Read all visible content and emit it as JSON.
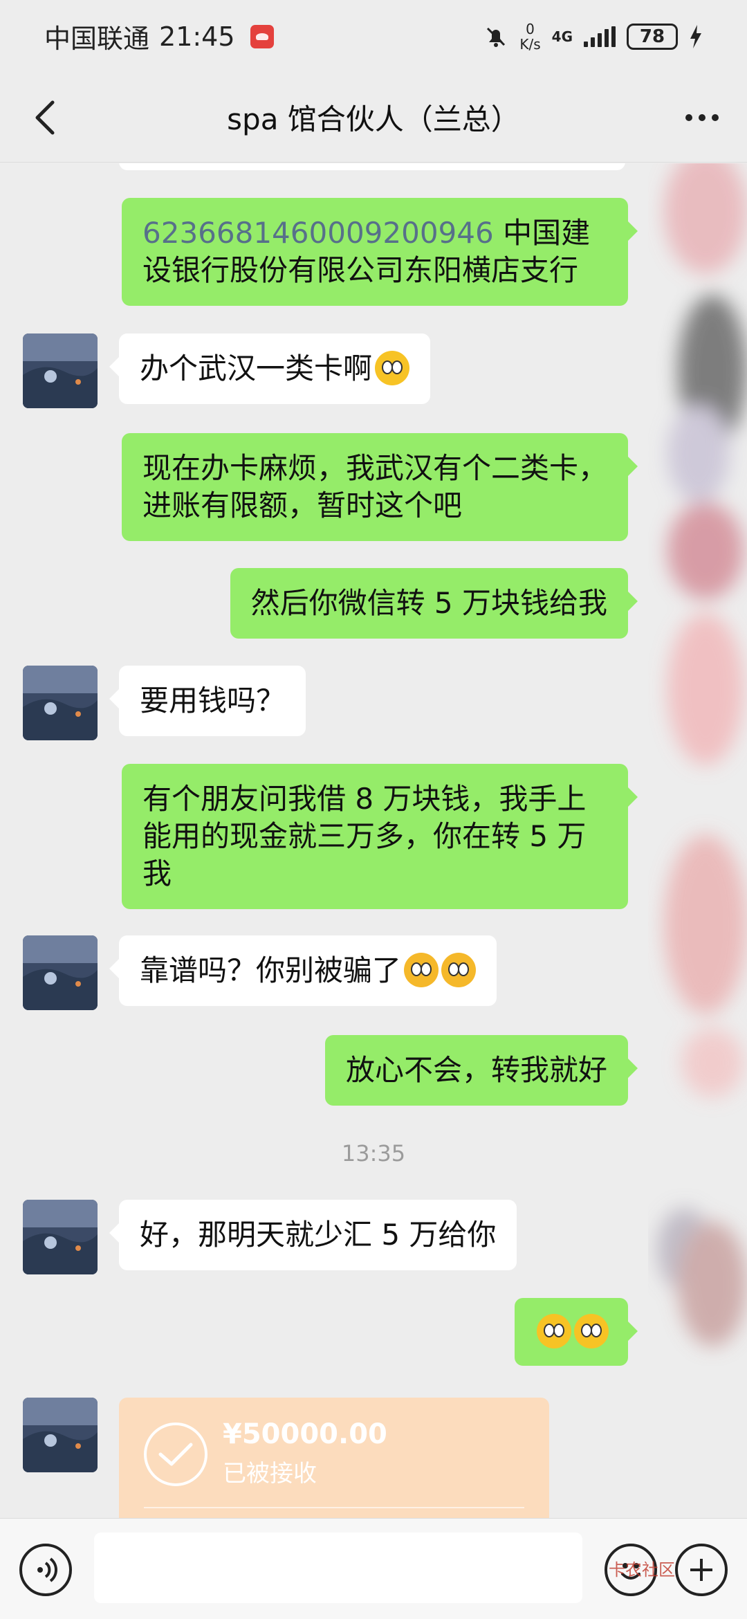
{
  "status_bar": {
    "carrier": "中国联通",
    "time": "21:45",
    "net_speed_value": "0",
    "net_speed_unit": "K/s",
    "network": "4G",
    "battery": "78"
  },
  "header": {
    "title": "spa 馆合伙人（兰总）",
    "back_icon": "chevron-left-icon",
    "more_icon": "more-dots-icon"
  },
  "messages": [
    {
      "side": "out",
      "account": "6236681460009200946",
      "text": " 中国建设银行股份有限公司东阳横店支行"
    },
    {
      "side": "in",
      "text": "办个武汉一类卡啊"
    },
    {
      "side": "out",
      "text": "现在办卡麻烦，我武汉有个二类卡，进账有限额，暂时这个吧"
    },
    {
      "side": "out",
      "text": "然后你微信转 5 万块钱给我"
    },
    {
      "side": "in",
      "text": "要用钱吗？"
    },
    {
      "side": "out",
      "text": "有个朋友问我借 8 万块钱，我手上能用的现金就三万多，你在转 5 万我"
    },
    {
      "side": "in",
      "text": "靠谱吗？你别被骗了"
    },
    {
      "side": "out",
      "text": "放心不会，转我就好"
    },
    {
      "side": "in",
      "text": "好，那明天就少汇 5 万给你"
    }
  ],
  "time_divider": "13:35",
  "transfer": {
    "amount": "¥50000.00",
    "status": "已被接收"
  },
  "input_bar": {
    "placeholder": "",
    "voice_icon": "voice-icon",
    "emoji_icon": "emoji-icon",
    "plus_icon": "plus-icon",
    "watermark": "卡农社区"
  }
}
